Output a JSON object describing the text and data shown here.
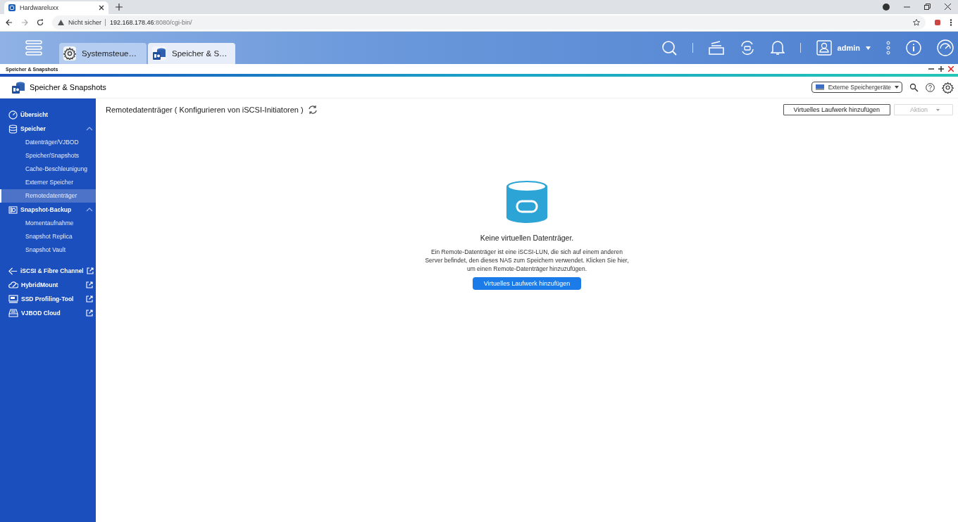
{
  "browser": {
    "tab": {
      "title": "Hardwareluxx"
    },
    "address": {
      "security": "Nicht sicher",
      "host": "192.168.178.46",
      "path": ":8080/cgi-bin/"
    }
  },
  "desktop": {
    "tabs": [
      {
        "label": "Systemsteue…",
        "selected": false
      },
      {
        "label": "Speicher & S…",
        "selected": true
      }
    ],
    "user": "admin"
  },
  "window": {
    "title": "Speicher & Snapshots"
  },
  "app": {
    "title": "Speicher & Snapshots",
    "external_button": "Externe Speichergeräte"
  },
  "sidebar": {
    "items": [
      {
        "label": "Übersicht",
        "kind": "section",
        "selected": false
      },
      {
        "label": "Speicher",
        "kind": "section",
        "selected": false,
        "expanded": true,
        "children": [
          {
            "label": "Datenträger/VJBOD",
            "selected": false
          },
          {
            "label": "Speicher/Snapshots",
            "selected": false
          },
          {
            "label": "Cache-Beschleunigung",
            "selected": false
          },
          {
            "label": "Externer Speicher",
            "selected": false
          },
          {
            "label": "Remotedatenträger",
            "selected": true
          }
        ]
      },
      {
        "label": "Snapshot-Backup",
        "kind": "section",
        "selected": false,
        "expanded": true,
        "children": [
          {
            "label": "Momentaufnahme",
            "selected": false
          },
          {
            "label": "Snapshot Replica",
            "selected": false
          },
          {
            "label": "Snapshot Vault",
            "selected": false
          }
        ]
      },
      {
        "label": "iSCSI & Fibre Channel",
        "kind": "external",
        "selected": false
      },
      {
        "label": "HybridMount",
        "kind": "external",
        "selected": false
      },
      {
        "label": "SSD Profiling-Tool",
        "kind": "external",
        "selected": false
      },
      {
        "label": "VJBOD Cloud",
        "kind": "external",
        "selected": false
      }
    ]
  },
  "content": {
    "title": "Remotedatenträger ( Konfigurieren von iSCSI-Initiatoren )",
    "buttons": [
      {
        "label": "Virtuelles Laufwerk hinzufügen",
        "kind": "button",
        "disabled": false
      },
      {
        "label": "Aktion",
        "kind": "dropdown",
        "disabled": true
      }
    ],
    "empty_state": {
      "heading": "Keine virtuellen Datenträger.",
      "text": "Ein Remote-Datenträger ist eine iSCSI-LUN, die sich auf einem anderen Server befindet, den dieses NAS zum Speichern verwendet. Klicken Sie hier, um einen Remote-Datenträger hinzuzufügen.",
      "button": "Virtuelles Laufwerk hinzufügen"
    }
  }
}
